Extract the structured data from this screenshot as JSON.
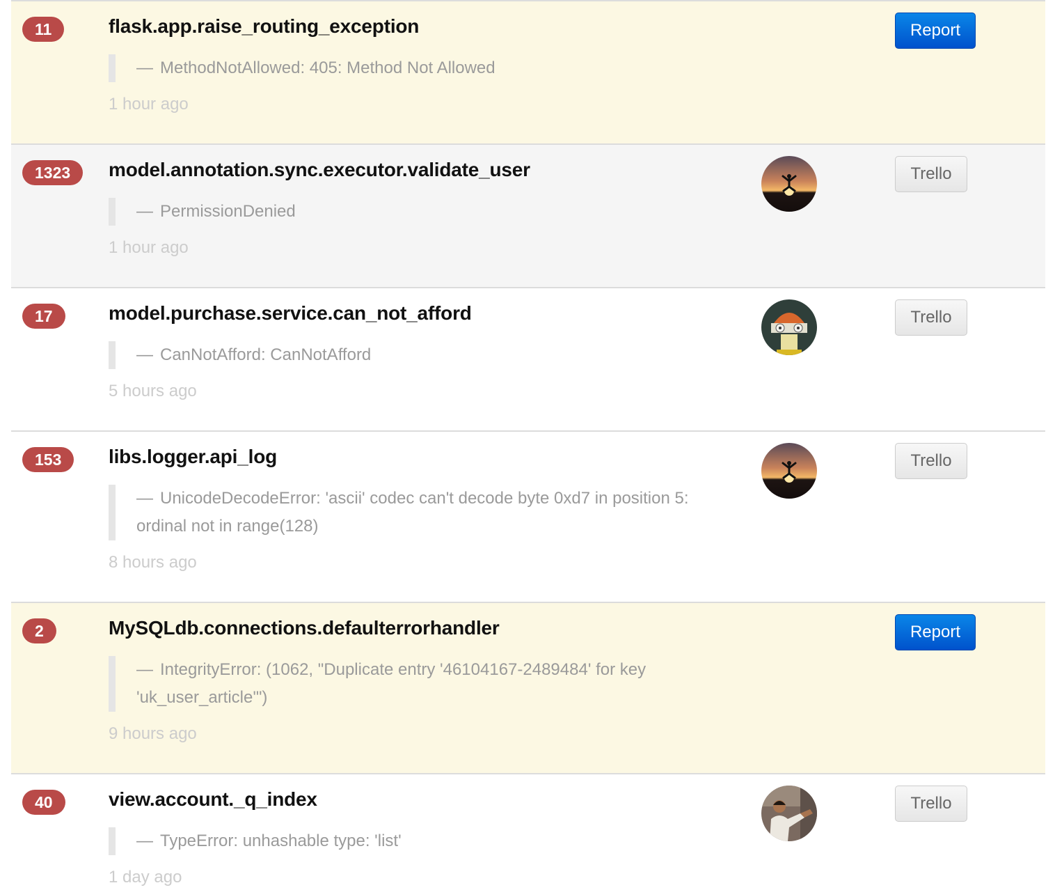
{
  "errors": [
    {
      "count": "11",
      "title": "flask.app.raise_routing_exception",
      "dash": "—",
      "message": "MethodNotAllowed: 405: Method Not Allowed",
      "time": "1 hour ago",
      "action_label": "Report",
      "avatar": "none",
      "row_color": "#fcf8e3"
    },
    {
      "count": "1323",
      "title": "model.annotation.sync.executor.validate_user",
      "dash": "—",
      "message": "PermissionDenied",
      "time": "1 hour ago",
      "action_label": "Trello",
      "avatar": "sunset-jump-avatar",
      "row_color": "#f5f5f5"
    },
    {
      "count": "17",
      "title": "model.purchase.service.can_not_afford",
      "dash": "—",
      "message": "CanNotAfford: CanNotAfford",
      "time": "5 hours ago",
      "action_label": "Trello",
      "avatar": "robot-avatar",
      "row_color": "#ffffff"
    },
    {
      "count": "153",
      "title": "libs.logger.api_log",
      "dash": "—",
      "message": "UnicodeDecodeError: 'ascii' codec can't decode byte 0xd7 in position 5: ordinal not in range(128)",
      "time": "8 hours ago",
      "action_label": "Trello",
      "avatar": "sunset-jump-avatar",
      "row_color": "#ffffff"
    },
    {
      "count": "2",
      "title": "MySQLdb.connections.defaulterrorhandler",
      "dash": "—",
      "message": "IntegrityError: (1062, \"Duplicate entry '46104167-2489484' for key 'uk_user_article'\")",
      "time": "9 hours ago",
      "action_label": "Report",
      "avatar": "none",
      "row_color": "#fcf8e3"
    },
    {
      "count": "40",
      "title": "view.account._q_index",
      "dash": "—",
      "message": "TypeError: unhashable type: 'list'",
      "time": "1 day ago",
      "action_label": "Trello",
      "avatar": "person-photo-avatar",
      "row_color": "#ffffff"
    }
  ],
  "colors": {
    "badge": "#b94a48",
    "report_button": "#0066dd",
    "trello_button": "#eeeeee",
    "highlight_row": "#fcf8e3"
  }
}
